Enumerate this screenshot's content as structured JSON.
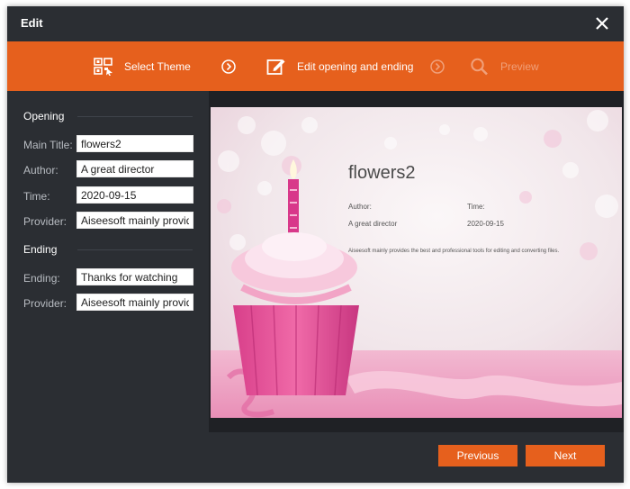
{
  "window": {
    "title": "Edit"
  },
  "steps": {
    "select_theme": "Select Theme",
    "edit_opening": "Edit opening and ending",
    "preview": "Preview"
  },
  "opening": {
    "section_label": "Opening",
    "main_title_label": "Main Title:",
    "main_title_value": "flowers2",
    "author_label": "Author:",
    "author_value": "A great director",
    "time_label": "Time:",
    "time_value": "2020-09-15",
    "provider_label": "Provider:",
    "provider_value": "Aiseesoft mainly provides the best and professional tools for editing and converting files."
  },
  "ending": {
    "section_label": "Ending",
    "ending_label": "Ending:",
    "ending_value": "Thanks for watching",
    "provider_label": "Provider:",
    "provider_value": "Aiseesoft mainly provides the best and professional tools for editing and converting files."
  },
  "preview": {
    "title": "flowers2",
    "author_label": "Author:",
    "author_value": "A great director",
    "time_label": "Time:",
    "time_value": "2020-09-15",
    "provider_text": "Aiseesoft mainly provides the best and professional tools for editing and converting files."
  },
  "footer": {
    "previous": "Previous",
    "next": "Next"
  },
  "colors": {
    "accent": "#e6601d",
    "panel": "#2b2e33",
    "preview_bg": "#1f2125"
  },
  "icons": [
    "close-icon",
    "theme-grid-icon",
    "arrow-right-circle-icon",
    "edit-icon",
    "search-icon"
  ]
}
